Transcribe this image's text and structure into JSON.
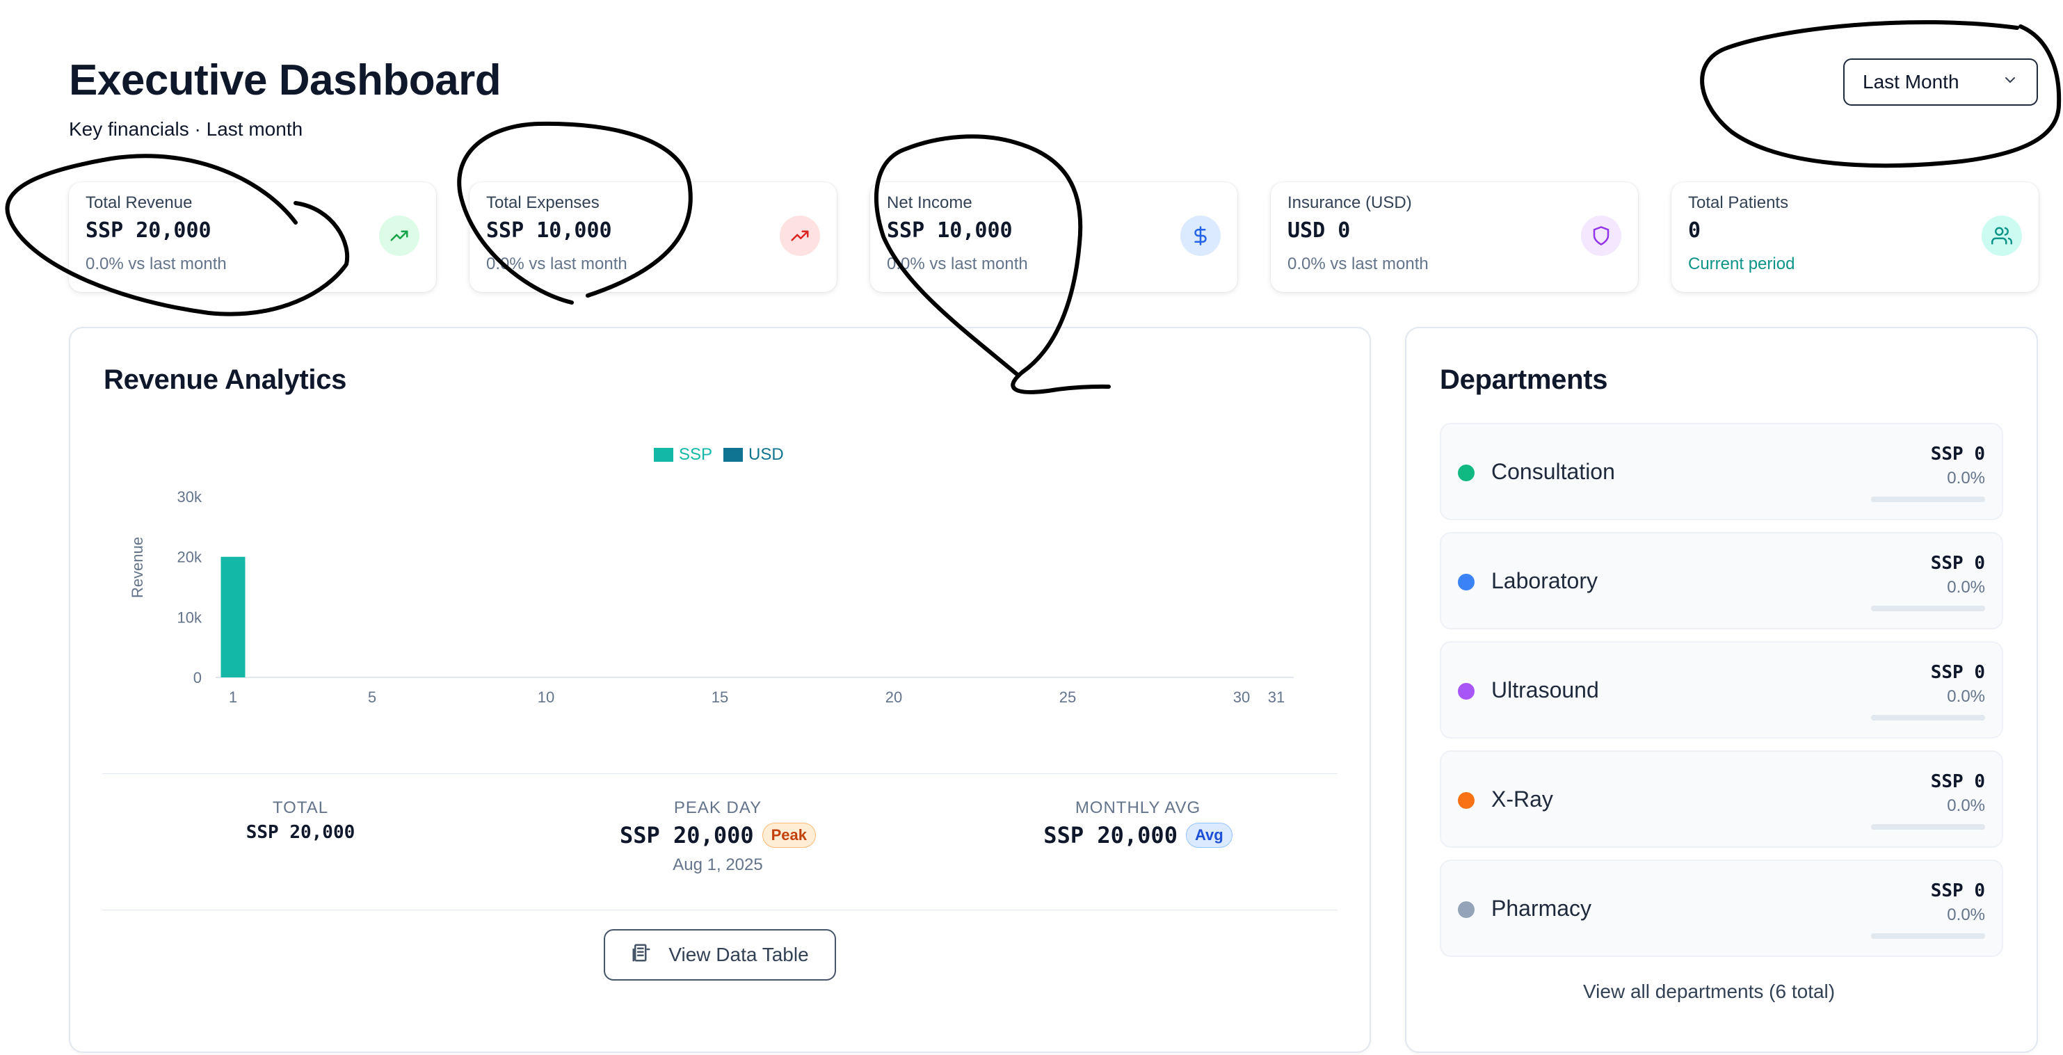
{
  "header": {
    "title": "Executive Dashboard",
    "subtitle": "Key financials · Last month",
    "period_select": "Last Month"
  },
  "kpis": [
    {
      "label": "Total Revenue",
      "value": "SSP 20,000",
      "sub": "0.0% vs last month",
      "icon": "trending-up-icon",
      "icon_color": "#16a34a",
      "icon_bg": "#dcfce7"
    },
    {
      "label": "Total Expenses",
      "value": "SSP 10,000",
      "sub": "0.0% vs last month",
      "icon": "trending-up-icon",
      "icon_color": "#dc2626",
      "icon_bg": "#fee2e2"
    },
    {
      "label": "Net Income",
      "value": "SSP 10,000",
      "sub": "0.0% vs last month",
      "icon": "dollar-icon",
      "icon_color": "#2563eb",
      "icon_bg": "#dbeafe"
    },
    {
      "label": "Insurance (USD)",
      "value": "USD 0",
      "sub": "0.0% vs last month",
      "icon": "shield-icon",
      "icon_color": "#9333ea",
      "icon_bg": "#f3e8ff"
    },
    {
      "label": "Total Patients",
      "value": "0",
      "sub": "Current period",
      "icon": "users-icon",
      "icon_color": "#0d9488",
      "icon_bg": "#ccfbf1"
    }
  ],
  "revenue": {
    "title": "Revenue Analytics",
    "stats": {
      "total_label": "TOTAL",
      "total_value": "SSP 20,000",
      "peak_label": "PEAK DAY",
      "peak_value": "SSP 20,000",
      "peak_badge": "Peak",
      "peak_date": "Aug 1, 2025",
      "avg_label": "MONTHLY AVG",
      "avg_value": "SSP 20,000",
      "avg_badge": "Avg"
    },
    "view_table_button": "View Data Table"
  },
  "chart_data": {
    "type": "bar",
    "ylabel": "Revenue",
    "ylim": [
      0,
      30000
    ],
    "y_ticks": [
      "0",
      "10k",
      "20k",
      "30k"
    ],
    "x_range": [
      1,
      31
    ],
    "x_ticks": [
      "1",
      "5",
      "10",
      "15",
      "20",
      "25",
      "30",
      "31"
    ],
    "legend_position": "top-center",
    "grid": false,
    "series": [
      {
        "name": "SSP",
        "color": "#14b8a6",
        "points": [
          {
            "x": 1,
            "y": 20000
          }
        ]
      },
      {
        "name": "USD",
        "color": "#0e7490",
        "points": []
      }
    ]
  },
  "departments": {
    "title": "Departments",
    "items": [
      {
        "name": "Consultation",
        "amount": "SSP 0",
        "pct": "0.0%",
        "share": 0,
        "color": "#10b981"
      },
      {
        "name": "Laboratory",
        "amount": "SSP 0",
        "pct": "0.0%",
        "share": 0,
        "color": "#3b82f6"
      },
      {
        "name": "Ultrasound",
        "amount": "SSP 0",
        "pct": "0.0%",
        "share": 0,
        "color": "#a855f7"
      },
      {
        "name": "X-Ray",
        "amount": "SSP 0",
        "pct": "0.0%",
        "share": 0,
        "color": "#f97316"
      },
      {
        "name": "Pharmacy",
        "amount": "SSP 0",
        "pct": "0.0%",
        "share": 0,
        "color": "#94a3b8"
      }
    ],
    "view_all": "View all departments (6 total)"
  }
}
